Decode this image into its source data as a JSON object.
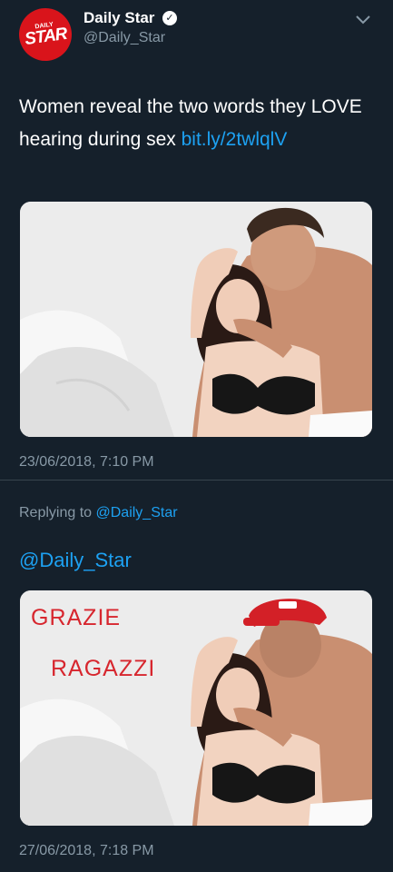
{
  "account": {
    "display_name": "Daily Star",
    "handle": "@Daily_Star",
    "verified_mark": "✓",
    "avatar_small": "DAILY",
    "avatar_big": "STAR"
  },
  "tweet": {
    "text": "Women reveal the two words they LOVE hearing during sex ",
    "link": "bit.ly/2twlqlV",
    "timestamp": "23/06/2018, 7:10 PM"
  },
  "reply": {
    "replying_prefix": "Replying to ",
    "replying_to": "@Daily_Star",
    "text": "@Daily_Star",
    "overlay_line1": "GRAZIE",
    "overlay_line2": "RAGAZZI",
    "timestamp": "27/06/2018, 7:18 PM"
  },
  "colors": {
    "background": "#15202b",
    "link": "#1da1f2",
    "secondary_text": "#8899a6",
    "brand_red": "#d9141b"
  },
  "icons": [
    "verified-badge-icon",
    "chevron-down-icon"
  ]
}
